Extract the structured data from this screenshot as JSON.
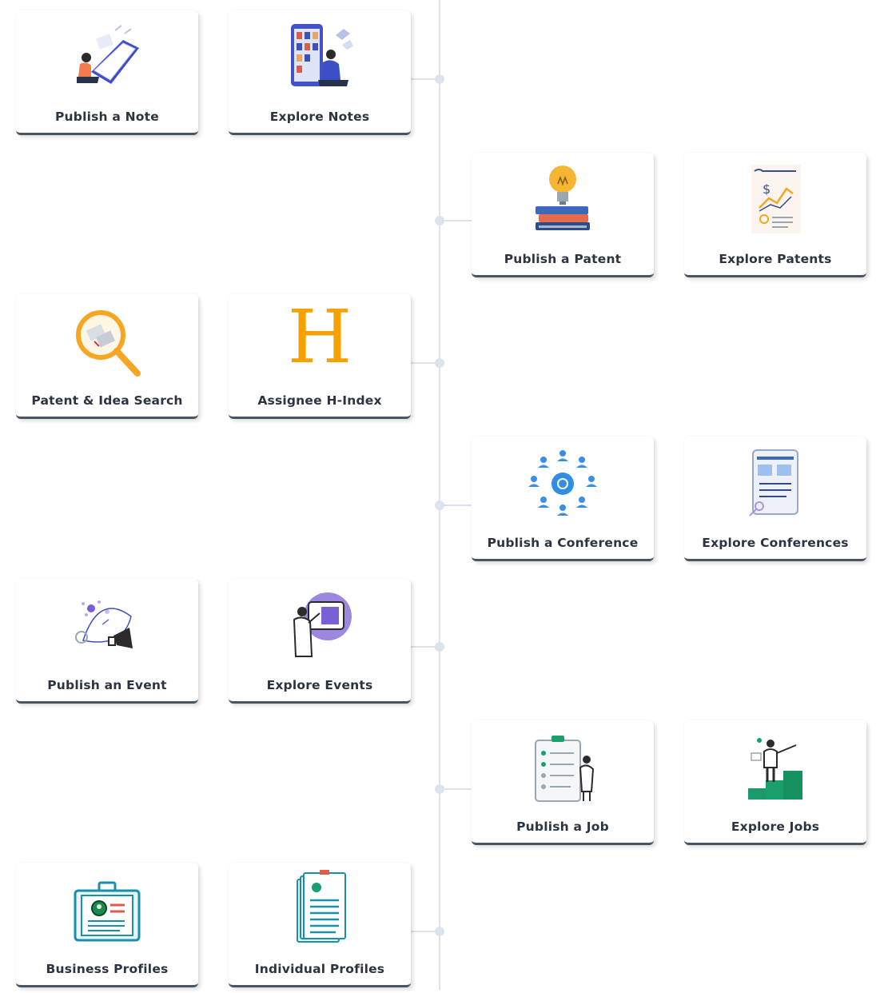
{
  "cards": [
    {
      "id": "publish-note",
      "label": "Publish a Note",
      "icon": "notepad-person-icon"
    },
    {
      "id": "explore-notes",
      "label": "Explore Notes",
      "icon": "bookshelf-reader-icon"
    },
    {
      "id": "publish-patent",
      "label": "Publish a Patent",
      "icon": "lightbulb-books-icon"
    },
    {
      "id": "explore-patents",
      "label": "Explore Patents",
      "icon": "patent-chart-document-icon"
    },
    {
      "id": "patent-idea-search",
      "label": "Patent & Idea Search",
      "icon": "magnifier-icon"
    },
    {
      "id": "assignee-h-index",
      "label": "Assignee H-Index",
      "icon": "letter-h-icon"
    },
    {
      "id": "publish-conference",
      "label": "Publish a Conference",
      "icon": "people-network-icon"
    },
    {
      "id": "explore-conferences",
      "label": "Explore Conferences",
      "icon": "tablet-document-icon"
    },
    {
      "id": "publish-event",
      "label": "Publish an Event",
      "icon": "megaphone-ideas-icon"
    },
    {
      "id": "explore-events",
      "label": "Explore Events",
      "icon": "presentation-screen-icon"
    },
    {
      "id": "publish-job",
      "label": "Publish a Job",
      "icon": "clipboard-checklist-icon"
    },
    {
      "id": "explore-jobs",
      "label": "Explore Jobs",
      "icon": "career-steps-icon"
    },
    {
      "id": "business-profiles",
      "label": "Business Profiles",
      "icon": "id-card-icon"
    },
    {
      "id": "individual-profiles",
      "label": "Individual Profiles",
      "icon": "profile-documents-icon"
    }
  ],
  "colors": {
    "timeline": "#dde3ea",
    "card_border": "#4a5563",
    "label_text": "#2b3440",
    "accent_orange": "#f5a623",
    "accent_blue": "#2f8fe6",
    "accent_green": "#1aa06d",
    "accent_teal": "#1a8fa8",
    "accent_purple": "#7b5fd6"
  }
}
